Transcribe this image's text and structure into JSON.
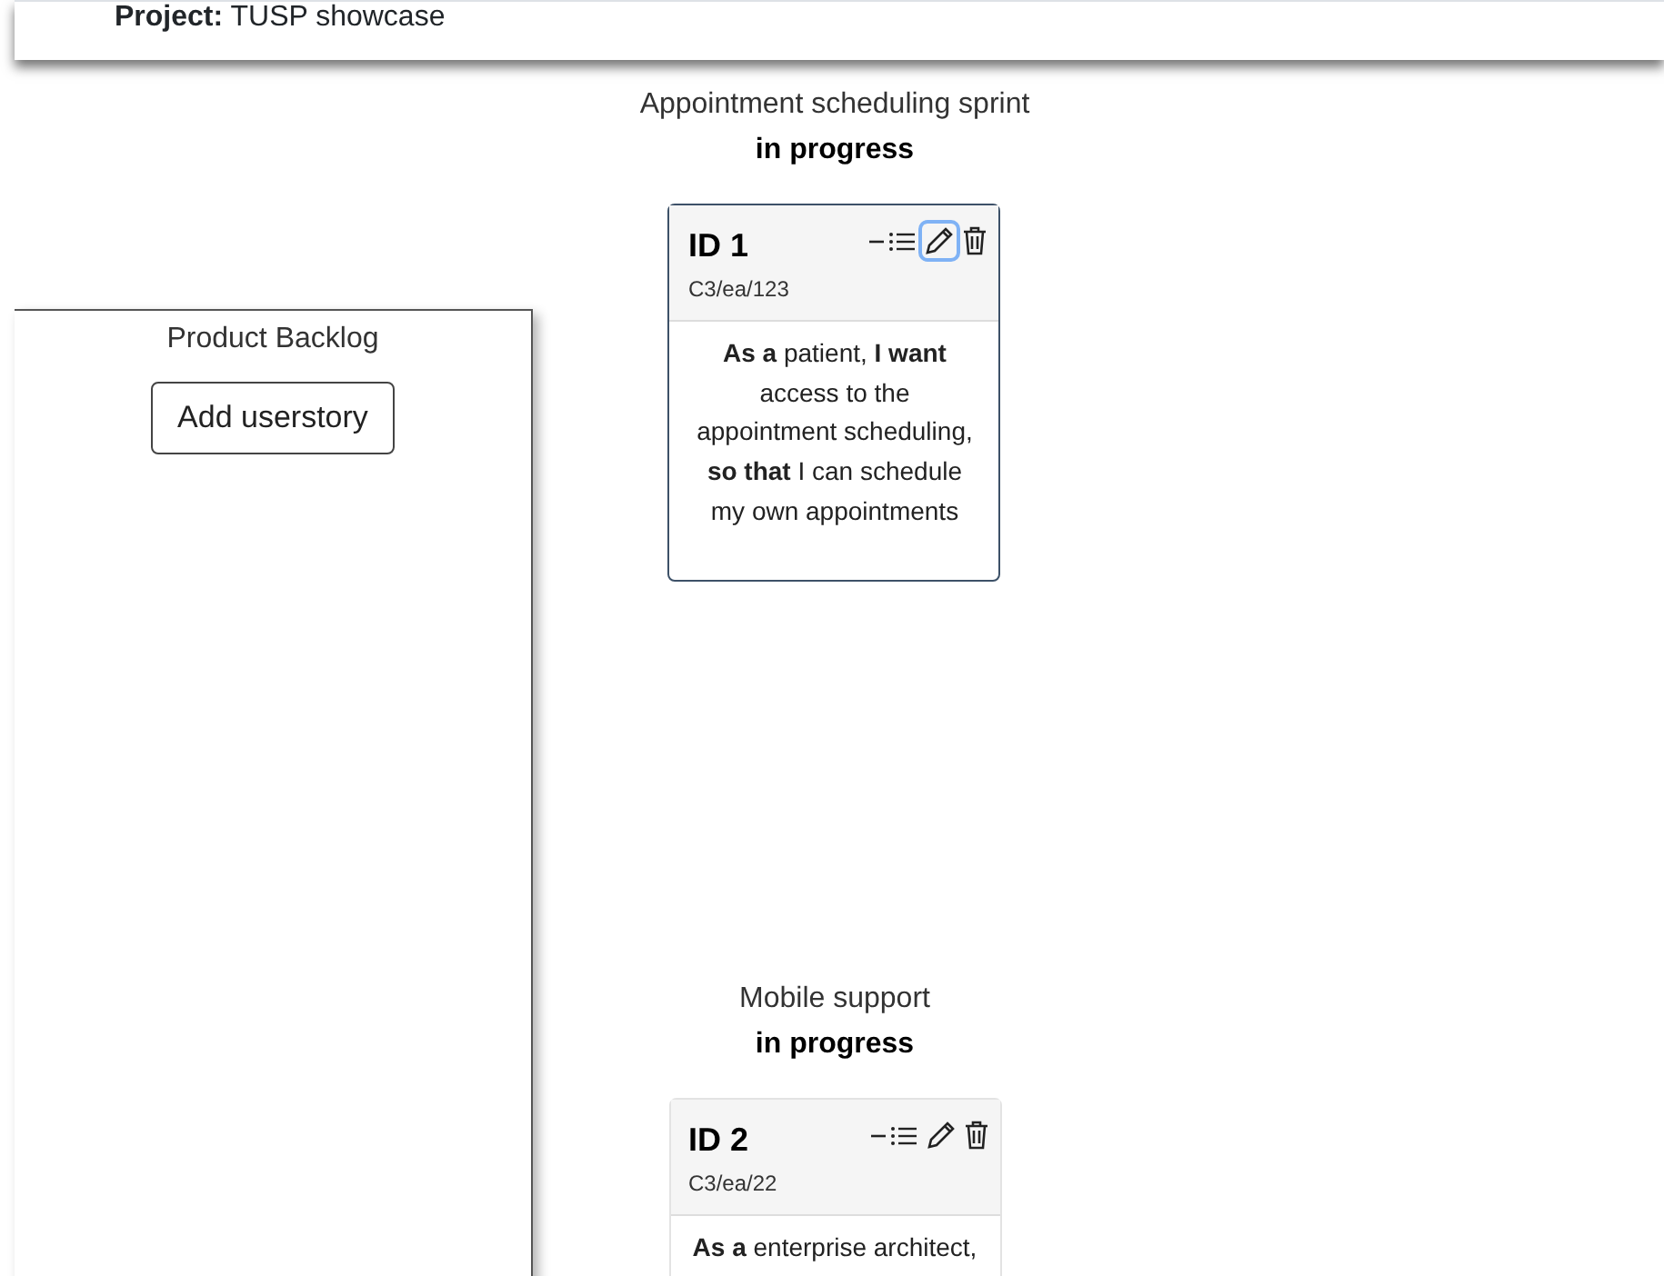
{
  "header": {
    "label": "Project:",
    "value": "TUSP showcase"
  },
  "backlog": {
    "title": "Product Backlog",
    "add_button": "Add userstory"
  },
  "sprints": [
    {
      "title": "Appointment scheduling sprint",
      "status": "in progress",
      "stories": [
        {
          "id": "ID 1",
          "code": "C3/ea/123",
          "edit_focused": true,
          "text": "**As a** patient, **I want** access to the appointment scheduling, **so that** I can schedule my own appointments"
        }
      ]
    },
    {
      "title": "Mobile support",
      "status": "in progress",
      "stories": [
        {
          "id": "ID 2",
          "code": "C3/ea/22",
          "edit_focused": false,
          "text": "**As a** enterprise architect,"
        }
      ]
    }
  ]
}
